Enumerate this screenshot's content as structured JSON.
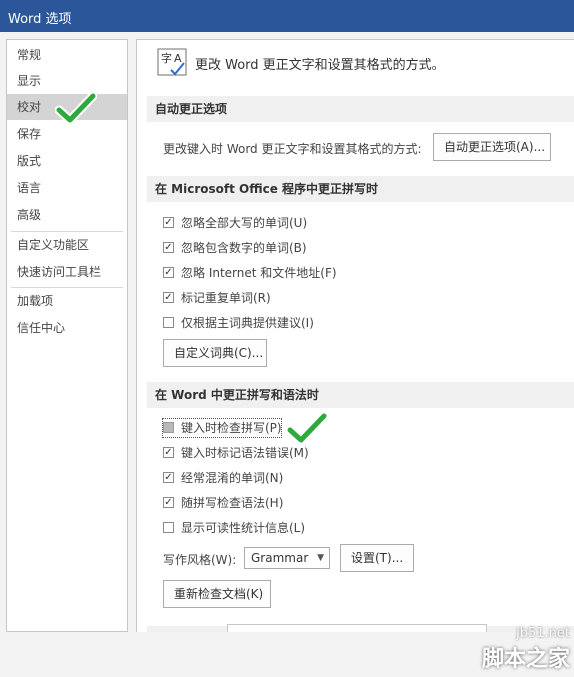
{
  "window": {
    "title": "Word 选项"
  },
  "sidebar": {
    "items": [
      {
        "label": "常规"
      },
      {
        "label": "显示"
      },
      {
        "label": "校对"
      },
      {
        "label": "保存"
      },
      {
        "label": "版式"
      },
      {
        "label": "语言"
      },
      {
        "label": "高级"
      },
      {
        "label": "自定义功能区"
      },
      {
        "label": "快速访问工具栏"
      },
      {
        "label": "加载项"
      },
      {
        "label": "信任中心"
      }
    ],
    "selected": "校对"
  },
  "header": {
    "text": "更改 Word 更正文字和设置其格式的方式。"
  },
  "autocorrect": {
    "title": "自动更正选项",
    "desc": "更改键入时 Word 更正文字和设置其格式的方式:",
    "button": "自动更正选项(A)..."
  },
  "office_spelling": {
    "title": "在 Microsoft Office 程序中更正拼写时",
    "options": [
      {
        "label": "忽略全部大写的单词(U)",
        "checked": true
      },
      {
        "label": "忽略包含数字的单词(B)",
        "checked": true
      },
      {
        "label": "忽略 Internet 和文件地址(F)",
        "checked": true
      },
      {
        "label": "标记重复单词(R)",
        "checked": true
      },
      {
        "label": "仅根据主词典提供建议(I)",
        "checked": false
      }
    ],
    "dict_button": "自定义词典(C)..."
  },
  "word_spelling": {
    "title": "在 Word 中更正拼写和语法时",
    "options": [
      {
        "label": "键入时检查拼写(P)",
        "checked": false
      },
      {
        "label": "键入时标记语法错误(M)",
        "checked": true
      },
      {
        "label": "经常混淆的单词(N)",
        "checked": true
      },
      {
        "label": "随拼写检查语法(H)",
        "checked": true
      },
      {
        "label": "显示可读性统计信息(L)",
        "checked": false
      }
    ],
    "style_label": "写作风格(W):",
    "style_value": "Grammar",
    "settings_button": "设置(T)...",
    "recheck_button": "重新检查文档(K)"
  },
  "watermark": {
    "line1": "jb51.net",
    "line2": "脚本之家"
  },
  "colors": {
    "title_bar": "#2b579a",
    "checkmark": "#2eaa3c"
  }
}
